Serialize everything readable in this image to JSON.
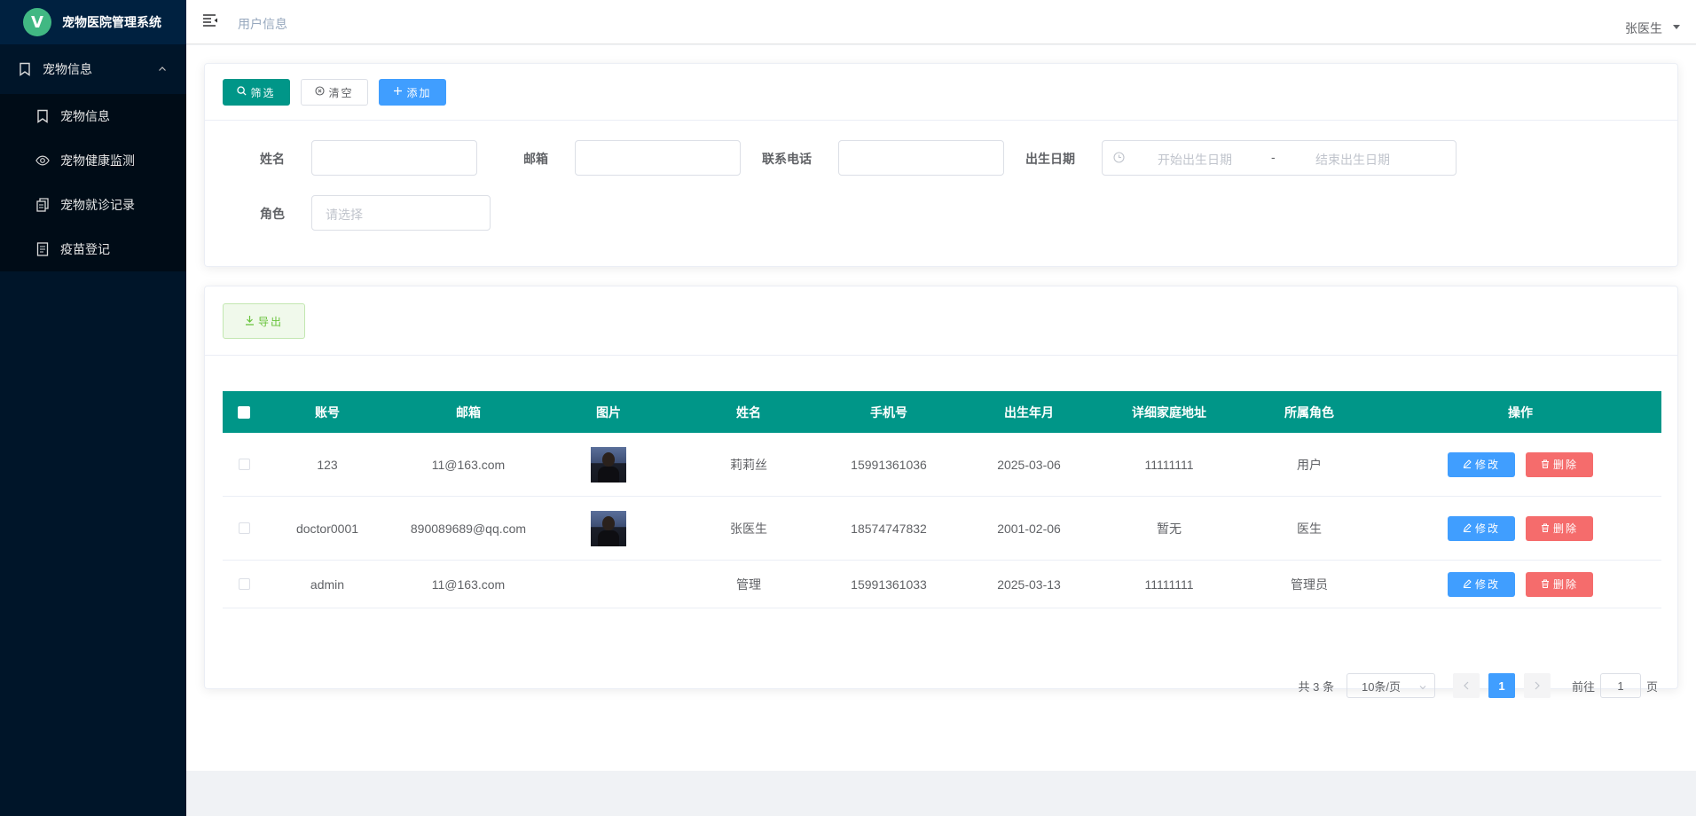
{
  "app": {
    "title": "宠物医院管理系统",
    "logo_letter": "V"
  },
  "sidebar": {
    "group": {
      "label": "宠物信息",
      "icon": "bookmark-icon"
    },
    "items": [
      {
        "label": "宠物信息",
        "icon": "bookmark-icon"
      },
      {
        "label": "宠物健康监测",
        "icon": "eye-icon"
      },
      {
        "label": "宠物就诊记录",
        "icon": "copy-icon"
      },
      {
        "label": "疫苗登记",
        "icon": "document-icon"
      }
    ]
  },
  "header": {
    "breadcrumb": "用户信息",
    "user": "张医生"
  },
  "toolbar": {
    "filter_label": "筛选",
    "clear_label": "清空",
    "add_label": "添加"
  },
  "form": {
    "name_label": "姓名",
    "email_label": "邮箱",
    "phone_label": "联系电话",
    "birth_label": "出生日期",
    "birth_start_placeholder": "开始出生日期",
    "birth_sep": "-",
    "birth_end_placeholder": "结束出生日期",
    "role_label": "角色",
    "role_placeholder": "请选择"
  },
  "export_label": "导出",
  "table": {
    "headers": [
      "账号",
      "邮箱",
      "图片",
      "姓名",
      "手机号",
      "出生年月",
      "详细家庭地址",
      "所属角色",
      "操作"
    ],
    "rows": [
      {
        "account": "123",
        "email": "11@163.com",
        "has_image": true,
        "name": "莉莉丝",
        "phone": "15991361036",
        "birth": "2025-03-06",
        "address": "11111111",
        "role": "用户"
      },
      {
        "account": "doctor0001",
        "email": "890089689@qq.com",
        "has_image": true,
        "name": "张医生",
        "phone": "18574747832",
        "birth": "2001-02-06",
        "address": "暂无",
        "role": "医生"
      },
      {
        "account": "admin",
        "email": "11@163.com",
        "has_image": false,
        "name": "管理",
        "phone": "15991361033",
        "birth": "2025-03-13",
        "address": "11111111",
        "role": "管理员"
      }
    ],
    "edit_label": "修改",
    "delete_label": "删除"
  },
  "pagination": {
    "total_text": "共 3 条",
    "page_size": "10条/页",
    "current_page": "1",
    "goto_prefix": "前往",
    "goto_value": "1",
    "goto_suffix": "页"
  },
  "colors": {
    "sidebar": "#001529",
    "primary_teal": "#009688",
    "primary_blue": "#409eff",
    "danger": "#f56c6c",
    "logo_green": "#41b883"
  }
}
